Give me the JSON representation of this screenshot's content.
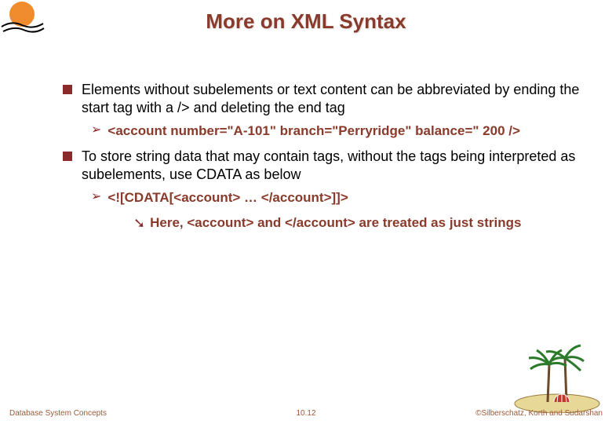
{
  "slide": {
    "title": "More on XML Syntax",
    "bullets": [
      {
        "text": "Elements without subelements or text content can be abbreviated by ending the start tag with a  />  and deleting the end tag",
        "sub": [
          {
            "text": "<account  number=\"A-101\"  branch=\"Perryridge\"  balance=\" 200 />"
          }
        ]
      },
      {
        "text": "To store string data that may contain tags, without the tags being interpreted as subelements, use CDATA as below",
        "sub": [
          {
            "text": "<![CDATA[<account> … </account>]]>",
            "sub": [
              {
                "text": "Here, <account> and </account> are treated as just strings"
              }
            ]
          }
        ]
      }
    ]
  },
  "footer": {
    "left": "Database System Concepts",
    "center": "10.12",
    "right": "©Silberschatz, Korth and Sudarshan"
  }
}
